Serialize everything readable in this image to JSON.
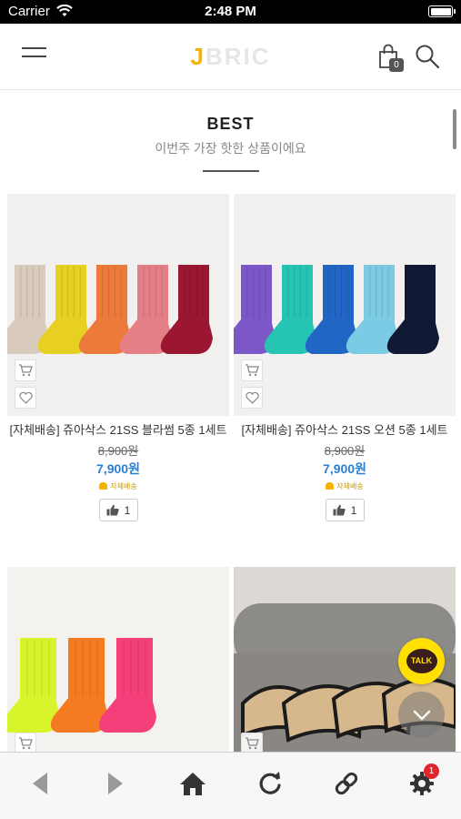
{
  "status_bar": {
    "carrier": "Carrier",
    "time": "2:48 PM"
  },
  "header": {
    "logo_letter": "J",
    "logo_rest": "BRIC",
    "cart_count": "0"
  },
  "section": {
    "title": "BEST",
    "subtitle": "이번주 가장 핫한 상품이에요"
  },
  "products": [
    {
      "name": "[자체배송] 쥬아삭스 21SS 블라썸 5종 1세트",
      "price_old": "8,900원",
      "price_new": "7,900원",
      "badge": "자체배송",
      "likes": "1",
      "colors": [
        "#d9cbbb",
        "#e8d022",
        "#ec7a3a",
        "#e47f86",
        "#9a1631"
      ]
    },
    {
      "name": "[자체배송] 쥬아삭스 21SS 오션 5종 1세트",
      "price_old": "8,900원",
      "price_new": "7,900원",
      "badge": "자체배송",
      "likes": "1",
      "colors": [
        "#7c57c8",
        "#25c4b3",
        "#2166c5",
        "#7ccbe4",
        "#111a35"
      ]
    },
    {
      "colors": [
        "#d8f52b",
        "#f57b22",
        "#f4407a"
      ]
    },
    {
      "colors": []
    }
  ],
  "floating": {
    "talk_label": "TALK"
  },
  "toolbar": {
    "settings_badge": "1"
  }
}
